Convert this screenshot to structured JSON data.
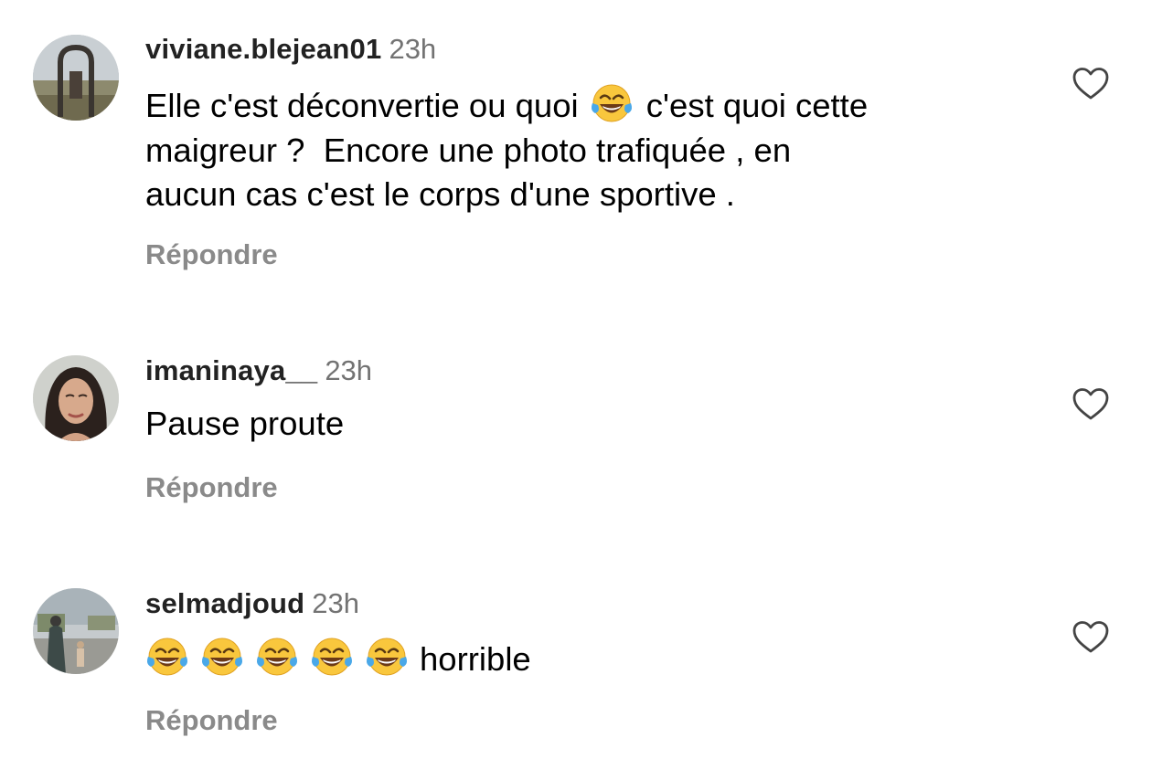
{
  "comments": [
    {
      "username": "viviane.blejean01",
      "time": "23h",
      "text_a": "Elle c'est déconvertie ou quoi ",
      "emoji": "face-with-tears-of-joy",
      "text_b": "c'est quoi cette\nmaigreur ?  Encore une photo trafiquée , en\naucun cas c'est le corps d'une sportive .",
      "reply_label": "Répondre"
    },
    {
      "username": "imaninaya__",
      "time": "23h",
      "text": "Pause proute",
      "reply_label": "Répondre"
    },
    {
      "username": "selmadjoud",
      "time": "23h",
      "emoji": "face-with-tears-of-joy",
      "emoji_count": 5,
      "text": "horrible",
      "reply_label": "Répondre"
    }
  ],
  "icons": {
    "like": "heart-outline-icon"
  }
}
